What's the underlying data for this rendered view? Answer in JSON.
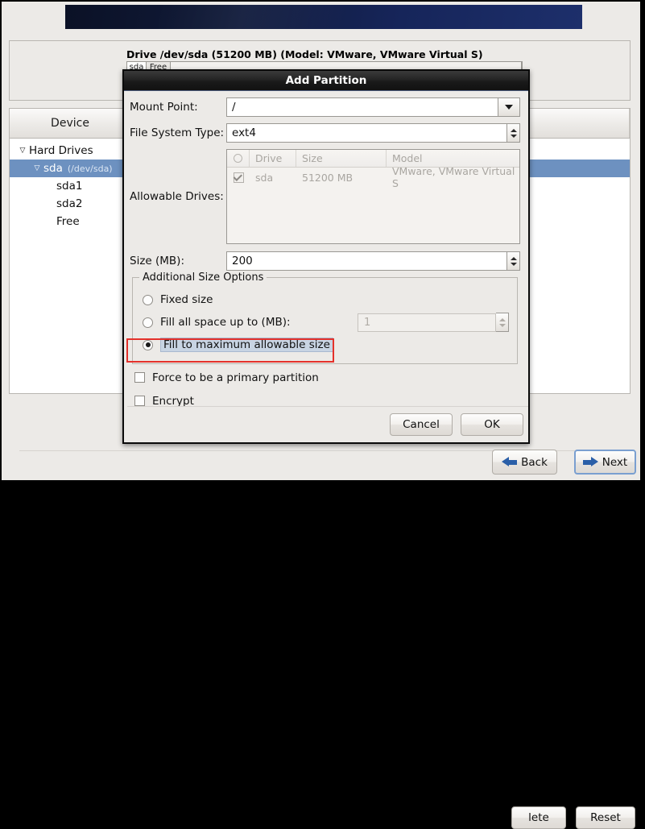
{
  "installer": {
    "drive_title": "Drive /dev/sda (51200 MB) (Model: VMware, VMware Virtual S)",
    "drive_bar": [
      {
        "label": "sda"
      },
      {
        "label": "Free"
      },
      {
        "label": ""
      }
    ],
    "device_column_header": "Device",
    "tree": [
      {
        "label": "Hard Drives",
        "detail": "",
        "level": 1,
        "expander": "▽",
        "selected": false
      },
      {
        "label": "sda",
        "detail": "(/dev/sda)",
        "level": 2,
        "expander": "▽",
        "selected": true
      },
      {
        "label": "sda1",
        "detail": "",
        "level": 3,
        "expander": "",
        "selected": false
      },
      {
        "label": "sda2",
        "detail": "",
        "level": 3,
        "expander": "",
        "selected": false
      },
      {
        "label": "Free",
        "detail": "",
        "level": 3,
        "expander": "",
        "selected": false
      }
    ],
    "buttons": {
      "delete": "lete",
      "reset": "Reset",
      "back": "Back",
      "next": "Next"
    },
    "accent_blue": "#2a5fa8",
    "banner_color": "#16255a"
  },
  "dialog": {
    "title": "Add Partition",
    "mount_point": {
      "label": "Mount Point:",
      "value": "/"
    },
    "file_system_type": {
      "label": "File System Type:",
      "value": "ext4"
    },
    "allowable_drives": {
      "label": "Allowable Drives:",
      "columns": [
        "O",
        "Drive",
        "Size",
        "Model"
      ],
      "rows": [
        {
          "checked": true,
          "drive": "sda",
          "size": "51200 MB",
          "model": "VMware, VMware Virtual S"
        }
      ]
    },
    "size": {
      "label": "Size (MB):",
      "value": "200"
    },
    "additional_size_options": {
      "legend": "Additional Size Options",
      "options": [
        {
          "label": "Fixed size",
          "selected": false
        },
        {
          "label": "Fill all space up to (MB):",
          "selected": false,
          "field_value": "1",
          "field_disabled": true
        },
        {
          "label": "Fill to maximum allowable size",
          "selected": true,
          "focused": true
        }
      ]
    },
    "checkboxes": [
      {
        "label": "Force to be a primary partition",
        "checked": false
      },
      {
        "label": "Encrypt",
        "checked": false
      }
    ],
    "buttons": {
      "cancel": "Cancel",
      "ok": "OK"
    }
  },
  "annotation": {
    "color": "#e4312b"
  }
}
